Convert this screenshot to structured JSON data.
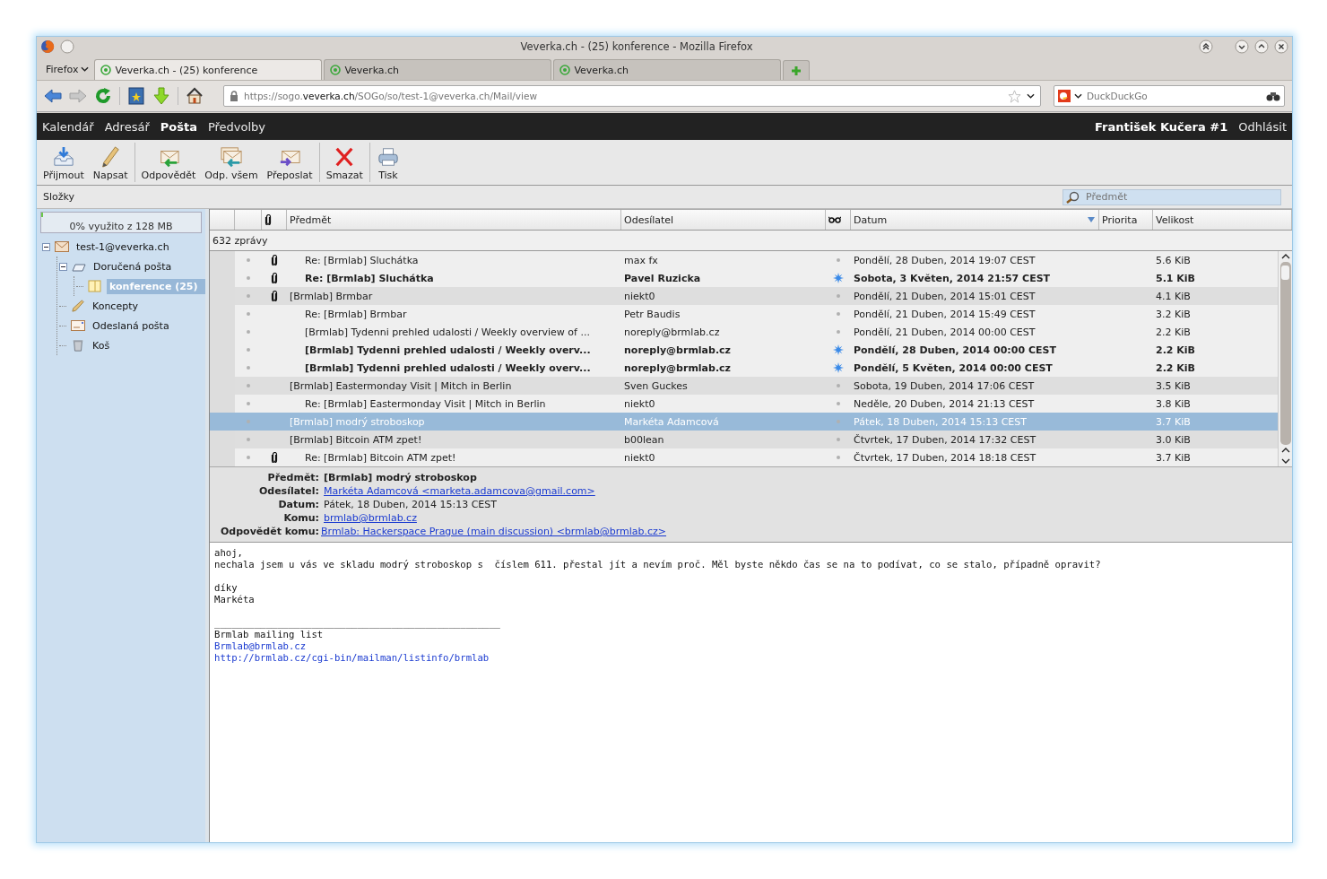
{
  "window": {
    "title": "Veverka.ch - (25) konference - Mozilla Firefox"
  },
  "browser": {
    "menu_button": "Firefox",
    "tabs": [
      {
        "label": "Veverka.ch - (25) konference",
        "selected": true
      },
      {
        "label": "Veverka.ch",
        "selected": false
      },
      {
        "label": "Veverka.ch",
        "selected": false
      }
    ],
    "url": {
      "prefix": "https://sogo.",
      "domain": "veverka.ch",
      "path": "/SOGo/so/test-1@veverka.ch/Mail/view"
    },
    "search_engine": {
      "placeholder": "DuckDuckGo"
    }
  },
  "app_nav": {
    "items": [
      {
        "label": "Kalendář",
        "selected": false
      },
      {
        "label": "Adresář",
        "selected": false
      },
      {
        "label": "Pošta",
        "selected": true
      },
      {
        "label": "Předvolby",
        "selected": false
      }
    ],
    "user": "František Kučera #1",
    "logout": "Odhlásit"
  },
  "toolbar": [
    {
      "buttons": [
        {
          "kind": "receive",
          "label": "Přijmout"
        },
        {
          "kind": "compose",
          "label": "Napsat"
        }
      ]
    },
    {
      "buttons": [
        {
          "kind": "reply",
          "label": "Odpovědět"
        },
        {
          "kind": "reply-all",
          "label": "Odp. všem"
        },
        {
          "kind": "forward",
          "label": "Přeposlat"
        }
      ]
    },
    {
      "buttons": [
        {
          "kind": "delete",
          "label": "Smazat"
        }
      ]
    },
    {
      "buttons": [
        {
          "kind": "print",
          "label": "Tisk"
        }
      ]
    }
  ],
  "folders": {
    "title": "Složky",
    "quota": {
      "level": 0.01,
      "text": "0% využito z 128 MB"
    },
    "tree": [
      {
        "label": "test-1@veverka.ch",
        "kind": "account",
        "expanded": true,
        "selected": false,
        "children": [
          {
            "label": "Doručená pošta",
            "kind": "inbox",
            "expanded": true,
            "selected": false,
            "children": [
              {
                "label": "konference (25)",
                "kind": "folder",
                "selected": true
              }
            ]
          },
          {
            "label": "Koncepty",
            "kind": "drafts",
            "selected": false
          },
          {
            "label": "Odeslaná pošta",
            "kind": "sent",
            "selected": false
          },
          {
            "label": "Koš",
            "kind": "trash",
            "selected": false
          }
        ]
      }
    ]
  },
  "search": {
    "placeholder": "Předmět"
  },
  "messages": {
    "columns": [
      {
        "kind": "blank"
      },
      {
        "kind": "blank"
      },
      {
        "kind": "attachment"
      },
      {
        "kind": "text",
        "label": "Předmět",
        "sorted": false
      },
      {
        "kind": "text",
        "label": "Odesílatel",
        "sorted": false
      },
      {
        "kind": "unread"
      },
      {
        "kind": "text",
        "label": "Datum",
        "sorted": true
      },
      {
        "kind": "text",
        "label": "Priorita",
        "sorted": false
      },
      {
        "kind": "text",
        "label": "Velikost",
        "sorted": false
      }
    ],
    "count": "632 zprávy",
    "rows": [
      {
        "kind": "reply",
        "subject": "Re: [Brmlab] Sluchátka",
        "sender": "max fx",
        "date": "Pondělí, 28 Duben, 2014 19:07 CEST",
        "size": "5.6 KiB",
        "attachment": true,
        "unread": false,
        "selected": false
      },
      {
        "kind": "reply",
        "subject": "Re: [Brmlab] Sluchátka",
        "sender": "Pavel Ruzicka",
        "date": "Sobota, 3 Květen, 2014 21:57 CEST",
        "size": "5.1 KiB",
        "attachment": true,
        "unread": true,
        "selected": false
      },
      {
        "kind": "thread",
        "subject": "[Brmlab] Brmbar",
        "sender": "niekt0",
        "date": "Pondělí, 21 Duben, 2014 15:01 CEST",
        "size": "4.1 KiB",
        "attachment": true,
        "unread": false,
        "selected": false
      },
      {
        "kind": "reply",
        "subject": "Re: [Brmlab] Brmbar",
        "sender": "Petr Baudis",
        "date": "Pondělí, 21 Duben, 2014 15:49 CEST",
        "size": "3.2 KiB",
        "attachment": false,
        "unread": false,
        "selected": false
      },
      {
        "kind": "reply",
        "subject": "[Brmlab] Tydenni prehled udalosti / Weekly overview of ...",
        "sender": "noreply@brmlab.cz",
        "date": "Pondělí, 21 Duben, 2014 00:00 CEST",
        "size": "2.2 KiB",
        "attachment": false,
        "unread": false,
        "selected": false
      },
      {
        "kind": "reply",
        "subject": "[Brmlab] Tydenni prehled udalosti / Weekly overv...",
        "sender": "noreply@brmlab.cz",
        "date": "Pondělí, 28 Duben, 2014 00:00 CEST",
        "size": "2.2 KiB",
        "attachment": false,
        "unread": true,
        "selected": false
      },
      {
        "kind": "reply",
        "subject": "[Brmlab] Tydenni prehled udalosti / Weekly overv...",
        "sender": "noreply@brmlab.cz",
        "date": "Pondělí, 5 Květen, 2014 00:00 CEST",
        "size": "2.2 KiB",
        "attachment": false,
        "unread": true,
        "selected": false
      },
      {
        "kind": "thread",
        "subject": "[Brmlab] Eastermonday Visit | Mitch in Berlin",
        "sender": "Sven Guckes",
        "date": "Sobota, 19 Duben, 2014 17:06 CEST",
        "size": "3.5 KiB",
        "attachment": false,
        "unread": false,
        "selected": false
      },
      {
        "kind": "reply",
        "subject": "Re: [Brmlab] Eastermonday Visit | Mitch in Berlin",
        "sender": "niekt0",
        "date": "Neděle, 20 Duben, 2014 21:13 CEST",
        "size": "3.8 KiB",
        "attachment": false,
        "unread": false,
        "selected": false
      },
      {
        "kind": "thread",
        "subject": "[Brmlab] modrý stroboskop",
        "sender": "Markéta Adamcová",
        "date": "Pátek, 18 Duben, 2014 15:13 CEST",
        "size": "3.7 KiB",
        "attachment": false,
        "unread": false,
        "selected": true
      },
      {
        "kind": "thread",
        "subject": "[Brmlab] Bitcoin ATM zpet!",
        "sender": "b00lean",
        "date": "Čtvrtek, 17 Duben, 2014 17:32 CEST",
        "size": "3.0 KiB",
        "attachment": false,
        "unread": false,
        "selected": false
      },
      {
        "kind": "reply",
        "subject": "Re: [Brmlab] Bitcoin ATM zpet!",
        "sender": "niekt0",
        "date": "Čtvrtek, 17 Duben, 2014 18:18 CEST",
        "size": "3.7 KiB",
        "attachment": true,
        "unread": false,
        "selected": false
      }
    ]
  },
  "preview": {
    "headers": [
      {
        "label": "Předmět:",
        "kind": "bold",
        "value": "[Brmlab] modrý stroboskop"
      },
      {
        "label": "Odesílatel:",
        "kind": "link",
        "value": "Markéta Adamcová <marketa.adamcova@gmail.com>"
      },
      {
        "label": "Datum:",
        "kind": "text",
        "value": "Pátek, 18 Duben, 2014 15:13 CEST"
      },
      {
        "label": "Komu:",
        "kind": "link",
        "value": "brmlab@brmlab.cz"
      },
      {
        "label": "Odpovědět komu:",
        "kind": "link",
        "value": "Brmlab: Hackerspace Prague (main discussion) <brmlab@brmlab.cz>"
      }
    ],
    "body": [
      {
        "kind": "text",
        "text": "ahoj,"
      },
      {
        "kind": "text",
        "text": "nechala jsem u vás ve skladu modrý stroboskop s  číslem 611. přestal jít a nevím proč. Měl byste někdo čas se na to podívat, co se stalo, případně opravit?"
      },
      {
        "kind": "gap"
      },
      {
        "kind": "text",
        "text": "díky"
      },
      {
        "kind": "text",
        "text": "Markéta"
      },
      {
        "kind": "gap"
      },
      {
        "kind": "text",
        "text": "__________________________________________________"
      },
      {
        "kind": "text",
        "text": "Brmlab mailing list"
      },
      {
        "kind": "link",
        "text": "Brmlab@brmlab.cz"
      },
      {
        "kind": "link",
        "text": "http://brmlab.cz/cgi-bin/mailman/listinfo/brmlab"
      }
    ]
  }
}
